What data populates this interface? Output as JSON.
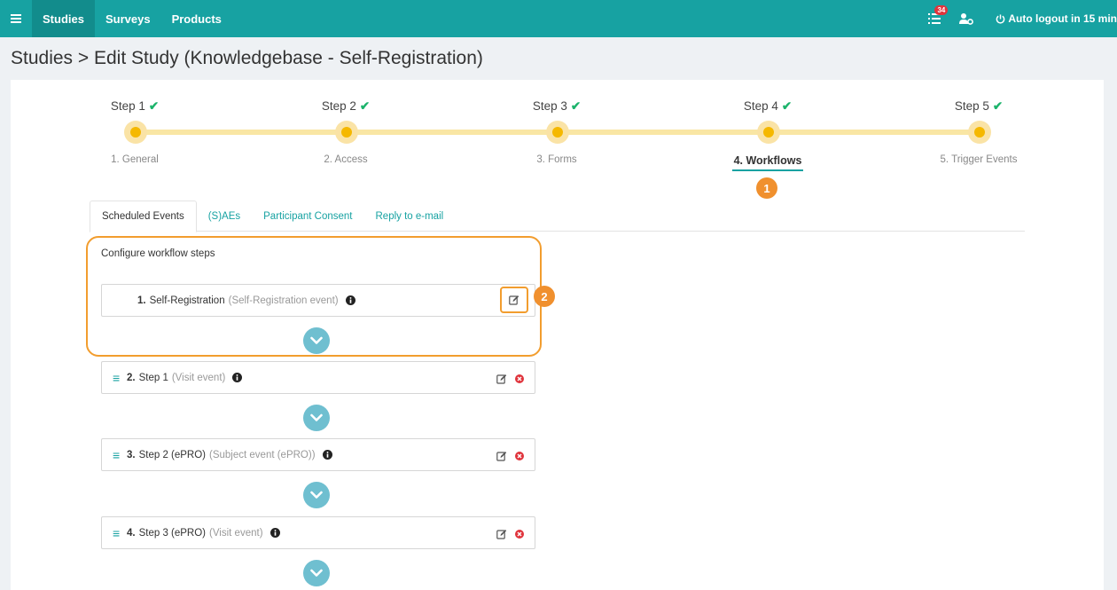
{
  "nav": {
    "menu_icon": "hamburger-icon",
    "tabs": [
      {
        "label": "Studies"
      },
      {
        "label": "Surveys"
      },
      {
        "label": "Products"
      }
    ],
    "notification_count": "34",
    "logout_text": "Auto logout in 15 min"
  },
  "page": {
    "title": "Studies > Edit Study (Knowledgebase - Self-Registration)"
  },
  "stepper": {
    "steps": [
      {
        "label": "Step 1",
        "name": "1. General"
      },
      {
        "label": "Step 2",
        "name": "2. Access"
      },
      {
        "label": "Step 3",
        "name": "3. Forms"
      },
      {
        "label": "Step 4",
        "name": "4. Workflows"
      },
      {
        "label": "Step 5",
        "name": "5. Trigger Events"
      }
    ],
    "check": "✔",
    "active_index": 3
  },
  "markers": {
    "one": "1",
    "two": "2"
  },
  "tabs": [
    {
      "label": "Scheduled Events"
    },
    {
      "label": "(S)AEs"
    },
    {
      "label": "Participant Consent"
    },
    {
      "label": "Reply to e-mail"
    }
  ],
  "workflow": {
    "heading": "Configure workflow steps",
    "items": [
      {
        "num": "1.",
        "title": "Self-Registration",
        "type": "(Self-Registration event)"
      },
      {
        "num": "2.",
        "title": "Step 1",
        "type": "(Visit event)"
      },
      {
        "num": "3.",
        "title": "Step 2 (ePRO)",
        "type": "(Subject event (ePRO))"
      },
      {
        "num": "4.",
        "title": "Step 3 (ePRO)",
        "type": "(Visit event)"
      }
    ]
  },
  "colors": {
    "primary": "#17a2a2",
    "accent": "#f29d2e",
    "step_dot": "#f5b800",
    "check": "#1bb36b",
    "delete": "#e0343c"
  }
}
